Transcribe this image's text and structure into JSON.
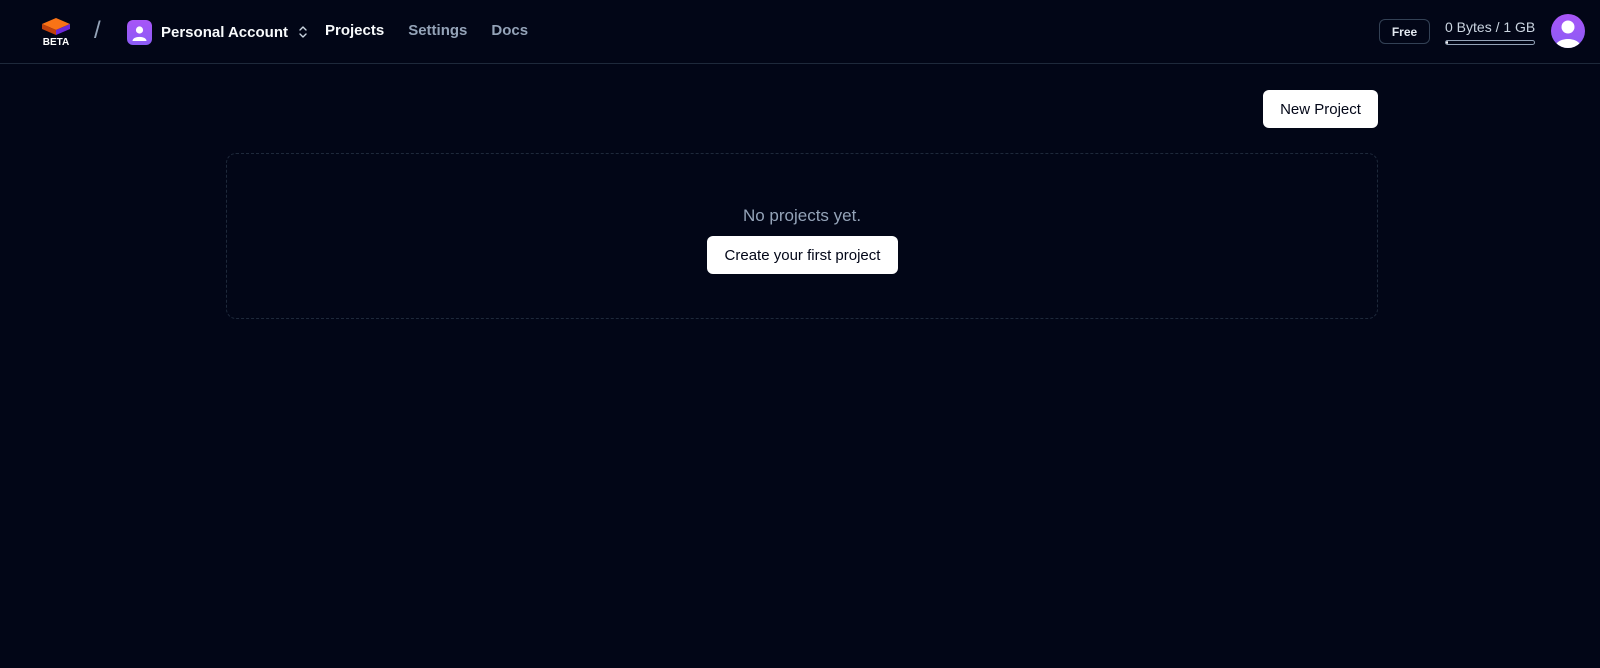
{
  "header": {
    "logo_label": "BETA",
    "account_name": "Personal Account",
    "nav": [
      {
        "label": "Projects",
        "active": true
      },
      {
        "label": "Settings",
        "active": false
      },
      {
        "label": "Docs",
        "active": false
      }
    ],
    "plan_badge": "Free",
    "storage_text": "0 Bytes / 1 GB",
    "storage_used_fraction": 0
  },
  "main": {
    "new_project_label": "New Project",
    "empty_message": "No projects yet.",
    "create_first_label": "Create your first project"
  },
  "colors": {
    "background": "#020617",
    "accent": "#8b5cf6",
    "border": "#1e293b"
  }
}
